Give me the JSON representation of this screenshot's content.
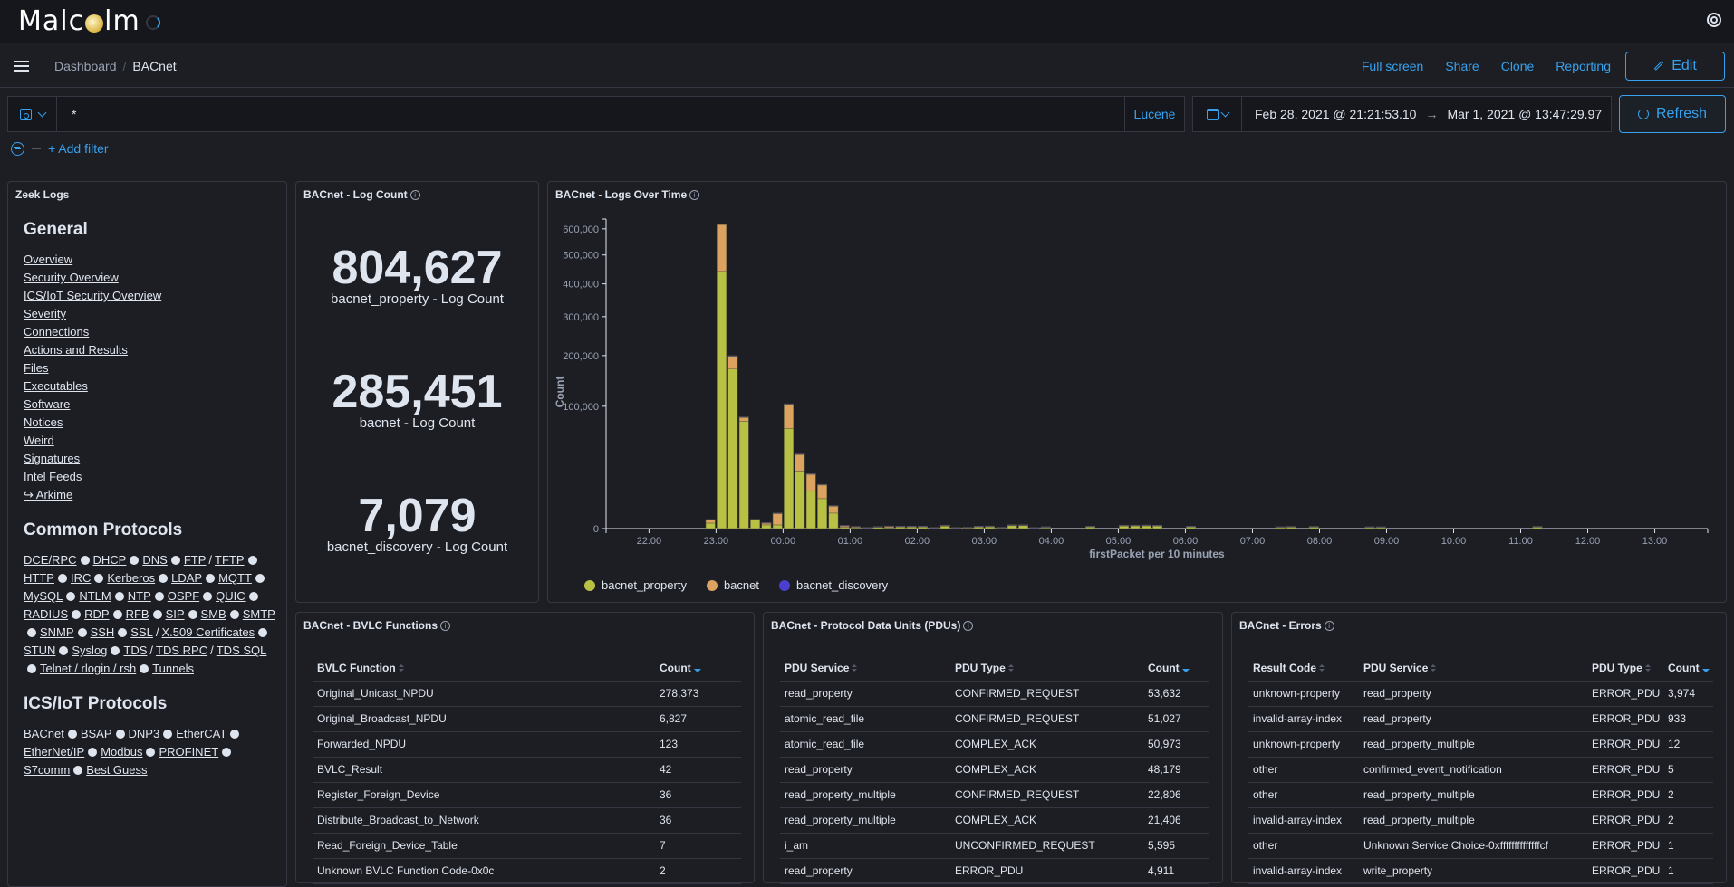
{
  "app": {
    "logo_text_1": "Malc",
    "logo_text_2": "lm"
  },
  "breadcrumb": {
    "parent": "Dashboard",
    "separator": "/",
    "current": "BACnet"
  },
  "nav_actions": {
    "full_screen": "Full screen",
    "share": "Share",
    "clone": "Clone",
    "reporting": "Reporting",
    "edit": "Edit"
  },
  "query": {
    "value": "*",
    "language": "Lucene"
  },
  "time_range": {
    "start": "Feb 28, 2021 @ 21:21:53.10",
    "arrow": "→",
    "end": "Mar 1, 2021 @ 13:47:29.97",
    "refresh": "Refresh"
  },
  "filter": {
    "add_label": "+ Add filter"
  },
  "zeek_logs": {
    "title": "Zeek Logs",
    "general_heading": "General",
    "general_links": [
      "Overview",
      "Security Overview",
      "ICS/IoT Security Overview",
      "Severity",
      "Connections",
      "Actions and Results",
      "Files",
      "Executables",
      "Software",
      "Notices",
      "Weird",
      "Signatures",
      "Intel Feeds",
      "↪ Arkime"
    ],
    "common_heading": "Common Protocols",
    "common_protocols": [
      [
        "DCE/RPC"
      ],
      [
        "DHCP"
      ],
      [
        "DNS"
      ],
      [
        "FTP",
        "TFTP"
      ],
      [
        "HTTP"
      ],
      [
        "IRC"
      ],
      [
        "Kerberos"
      ],
      [
        "LDAP"
      ],
      [
        "MQTT"
      ],
      [
        "MySQL"
      ],
      [
        "NTLM"
      ],
      [
        "NTP"
      ],
      [
        "OSPF"
      ],
      [
        "QUIC"
      ],
      [
        "RADIUS"
      ],
      [
        "RDP"
      ],
      [
        "RFB"
      ],
      [
        "SIP"
      ],
      [
        "SMB"
      ],
      [
        "SMTP"
      ],
      [
        "SNMP"
      ],
      [
        "SSH"
      ],
      [
        "SSL",
        "X.509 Certificates"
      ],
      [
        "STUN"
      ],
      [
        "Syslog"
      ],
      [
        "TDS",
        "TDS RPC",
        "TDS SQL"
      ],
      [
        "Telnet / rlogin / rsh"
      ],
      [
        "Tunnels"
      ]
    ],
    "ics_heading": "ICS/IoT Protocols",
    "ics_protocols": [
      [
        "BACnet"
      ],
      [
        "BSAP"
      ],
      [
        "DNP3"
      ],
      [
        "EtherCAT"
      ],
      [
        "EtherNet/IP"
      ],
      [
        "Modbus"
      ],
      [
        "PROFINET"
      ],
      [
        "S7comm"
      ],
      [
        "Best Guess"
      ]
    ]
  },
  "log_count": {
    "title": "BACnet - Log Count",
    "metrics": [
      {
        "value": "804,627",
        "label": "bacnet_property - Log Count"
      },
      {
        "value": "285,451",
        "label": "bacnet - Log Count"
      },
      {
        "value": "7,079",
        "label": "bacnet_discovery - Log Count"
      }
    ]
  },
  "logs_over_time": {
    "title": "BACnet - Logs Over Time"
  },
  "chart_data": {
    "type": "bar",
    "stacked": true,
    "title": "BACnet - Logs Over Time",
    "xlabel": "firstPacket per 10 minutes",
    "ylabel": "Count",
    "yscale": "sqrt",
    "ylim": [
      0,
      640000
    ],
    "yticks": [
      0,
      100000,
      200000,
      300000,
      400000,
      500000,
      600000
    ],
    "ytick_labels": [
      "0",
      "100,000",
      "200,000",
      "300,000",
      "400,000",
      "500,000",
      "600,000"
    ],
    "xlim_hours": [
      21.36,
      37.79
    ],
    "xticks_hours": [
      22,
      23,
      24,
      25,
      26,
      27,
      28,
      29,
      30,
      31,
      32,
      33,
      34,
      35,
      36,
      37
    ],
    "xtick_labels": [
      "22:00",
      "23:00",
      "00:00",
      "01:00",
      "02:00",
      "03:00",
      "04:00",
      "05:00",
      "06:00",
      "07:00",
      "08:00",
      "09:00",
      "10:00",
      "11:00",
      "12:00",
      "13:00"
    ],
    "legend_position": "bottom-left",
    "series": [
      {
        "name": "bacnet_property",
        "color": "#b9c144"
      },
      {
        "name": "bacnet",
        "color": "#dca25f"
      },
      {
        "name": "bacnet_discovery",
        "color": "#4b3fcf"
      }
    ],
    "bins": [
      {
        "t": "22:50",
        "values": [
          200,
          300,
          60
        ]
      },
      {
        "t": "23:00",
        "values": [
          442000,
          175000,
          3000
        ]
      },
      {
        "t": "23:10",
        "values": [
          170000,
          29000,
          800
        ]
      },
      {
        "t": "23:20",
        "values": [
          77000,
          6000,
          300
        ]
      },
      {
        "t": "23:30",
        "values": [
          500,
          60,
          20
        ]
      },
      {
        "t": "23:40",
        "values": [
          90,
          110,
          40
        ]
      },
      {
        "t": "23:50",
        "values": [
          90,
          1500,
          40
        ]
      },
      {
        "t": "00:00",
        "values": [
          67000,
          36000,
          1000
        ]
      },
      {
        "t": "00:10",
        "values": [
          22000,
          15000,
          200
        ]
      },
      {
        "t": "00:20",
        "values": [
          9300,
          10700,
          100
        ]
      },
      {
        "t": "00:30",
        "values": [
          6000,
          7000,
          60
        ]
      },
      {
        "t": "00:40",
        "values": [
          1600,
          1900,
          40
        ]
      },
      {
        "t": "00:50",
        "values": [
          10,
          40,
          20
        ]
      },
      {
        "t": "01:00",
        "values": [
          5,
          20,
          8
        ]
      },
      {
        "t": "01:10",
        "values": [
          0,
          5,
          3
        ]
      },
      {
        "t": "01:20",
        "values": [
          15,
          10,
          3
        ]
      },
      {
        "t": "01:30",
        "values": [
          5,
          30,
          10
        ]
      },
      {
        "t": "01:40",
        "values": [
          30,
          5,
          5
        ]
      },
      {
        "t": "01:50",
        "values": [
          30,
          5,
          5
        ]
      },
      {
        "t": "02:00",
        "values": [
          30,
          5,
          5
        ]
      },
      {
        "t": "02:10",
        "values": [
          0,
          5,
          3
        ]
      },
      {
        "t": "02:20",
        "values": [
          40,
          25,
          15
        ]
      },
      {
        "t": "02:30",
        "values": [
          0,
          5,
          3
        ]
      },
      {
        "t": "02:40",
        "values": [
          0,
          8,
          3
        ]
      },
      {
        "t": "02:50",
        "values": [
          25,
          10,
          5
        ]
      },
      {
        "t": "03:00",
        "values": [
          25,
          15,
          5
        ]
      },
      {
        "t": "03:10",
        "values": [
          3,
          5,
          3
        ]
      },
      {
        "t": "03:20",
        "values": [
          60,
          25,
          15
        ]
      },
      {
        "t": "03:30",
        "values": [
          60,
          25,
          10
        ]
      },
      {
        "t": "03:40",
        "values": [
          0,
          5,
          2
        ]
      },
      {
        "t": "03:50",
        "values": [
          5,
          15,
          3
        ]
      },
      {
        "t": "04:30",
        "values": [
          20,
          15,
          3
        ]
      },
      {
        "t": "05:00",
        "values": [
          50,
          25,
          5
        ]
      },
      {
        "t": "05:10",
        "values": [
          50,
          25,
          5
        ]
      },
      {
        "t": "05:20",
        "values": [
          50,
          30,
          5
        ]
      },
      {
        "t": "05:30",
        "values": [
          50,
          20,
          3
        ]
      },
      {
        "t": "06:00",
        "values": [
          20,
          15,
          3
        ]
      },
      {
        "t": "07:20",
        "values": [
          10,
          10,
          2
        ]
      },
      {
        "t": "07:30",
        "values": [
          20,
          10,
          2
        ]
      },
      {
        "t": "07:50",
        "values": [
          20,
          10,
          2
        ]
      },
      {
        "t": "08:40",
        "values": [
          10,
          10,
          2
        ]
      },
      {
        "t": "08:50",
        "values": [
          10,
          10,
          2
        ]
      },
      {
        "t": "11:10",
        "values": [
          20,
          10,
          2
        ]
      }
    ]
  },
  "bvlc_functions": {
    "title": "BACnet - BVLC Functions",
    "columns": [
      "BVLC Function",
      "Count"
    ],
    "rows": [
      [
        "Original_Unicast_NPDU",
        "278,373"
      ],
      [
        "Original_Broadcast_NPDU",
        "6,827"
      ],
      [
        "Forwarded_NPDU",
        "123"
      ],
      [
        "BVLC_Result",
        "42"
      ],
      [
        "Register_Foreign_Device",
        "36"
      ],
      [
        "Distribute_Broadcast_to_Network",
        "36"
      ],
      [
        "Read_Foreign_Device_Table",
        "7"
      ],
      [
        "Unknown BVLC Function Code-0x0c",
        "2"
      ]
    ]
  },
  "pdus": {
    "title": "BACnet - Protocol Data Units (PDUs)",
    "columns": [
      "PDU Service",
      "PDU Type",
      "Count"
    ],
    "rows": [
      [
        "read_property",
        "CONFIRMED_REQUEST",
        "53,632"
      ],
      [
        "atomic_read_file",
        "CONFIRMED_REQUEST",
        "51,027"
      ],
      [
        "atomic_read_file",
        "COMPLEX_ACK",
        "50,973"
      ],
      [
        "read_property",
        "COMPLEX_ACK",
        "48,179"
      ],
      [
        "read_property_multiple",
        "CONFIRMED_REQUEST",
        "22,806"
      ],
      [
        "read_property_multiple",
        "COMPLEX_ACK",
        "21,406"
      ],
      [
        "i_am",
        "UNCONFIRMED_REQUEST",
        "5,595"
      ],
      [
        "read_property",
        "ERROR_PDU",
        "4,911"
      ]
    ]
  },
  "errors": {
    "title": "BACnet - Errors",
    "columns": [
      "Result Code",
      "PDU Service",
      "PDU Type",
      "Count"
    ],
    "rows": [
      [
        "unknown-property",
        "read_property",
        "ERROR_PDU",
        "3,974"
      ],
      [
        "invalid-array-index",
        "read_property",
        "ERROR_PDU",
        "933"
      ],
      [
        "unknown-property",
        "read_property_multiple",
        "ERROR_PDU",
        "12"
      ],
      [
        "other",
        "confirmed_event_notification",
        "ERROR_PDU",
        "5"
      ],
      [
        "other",
        "read_property_multiple",
        "ERROR_PDU",
        "2"
      ],
      [
        "invalid-array-index",
        "read_property_multiple",
        "ERROR_PDU",
        "2"
      ],
      [
        "other",
        "Unknown Service Choice-0xffffffffffffffcf",
        "ERROR_PDU",
        "1"
      ],
      [
        "invalid-array-index",
        "write_property",
        "ERROR_PDU",
        "1"
      ]
    ]
  }
}
